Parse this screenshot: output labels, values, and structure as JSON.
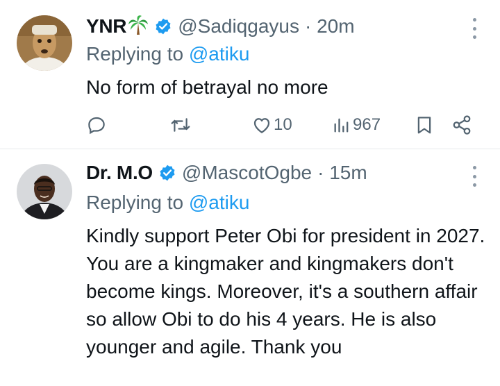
{
  "tweets": [
    {
      "name": "YNR",
      "name_emoji": "🌴",
      "handle": "@Sadiqgayus",
      "time": "· 20m",
      "replying_prefix": "Replying to ",
      "replying_handle": "@atiku",
      "text": "No form of betrayal no more",
      "likes": "10",
      "views": "967",
      "icons": [
        "reply-icon",
        "retweet-icon",
        "like-icon",
        "views-icon",
        "bookmark-icon",
        "share-icon"
      ]
    },
    {
      "name": "Dr. M.O",
      "handle": "@MascotOgbe",
      "time": "· 15m",
      "replying_prefix": "Replying to ",
      "replying_handle": "@atiku",
      "text": "Kindly support Peter Obi for president in 2027. You are a kingmaker and kingmakers don't become kings. Moreover, it's a southern affair so allow Obi to do his 4 years. He is also younger and agile. Thank you"
    }
  ],
  "colors": {
    "verified": "#1d9bf0",
    "link": "#1d9bf0",
    "muted": "#536471",
    "text": "#0f1419"
  }
}
